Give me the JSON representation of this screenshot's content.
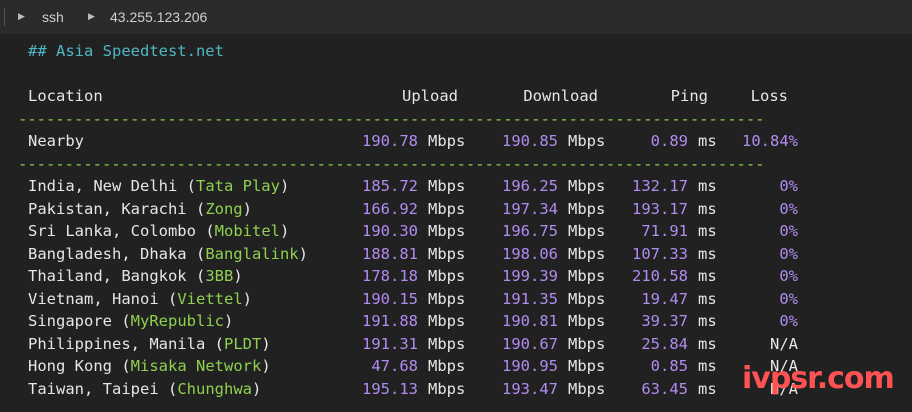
{
  "titlebar": {
    "tab": "ssh",
    "host": "43.255.123.206"
  },
  "section_heading": "## Asia Speedtest.net",
  "table": {
    "headers": {
      "location": "Location",
      "upload": "Upload",
      "download": "Download",
      "ping": "Ping",
      "loss": "Loss"
    },
    "divider": "--------------------------------------------------------------------------------",
    "unit_speed": "Mbps",
    "unit_ping": "ms",
    "nearby": {
      "location": "Nearby",
      "upload": "190.78",
      "download": "190.85",
      "ping": "0.89",
      "loss": "10.84%"
    },
    "rows": [
      {
        "city": "India, New Delhi",
        "isp": "Tata Play",
        "upload": "185.72",
        "download": "196.25",
        "ping": "132.17",
        "loss": "0%"
      },
      {
        "city": "Pakistan, Karachi",
        "isp": "Zong",
        "upload": "166.92",
        "download": "197.34",
        "ping": "193.17",
        "loss": "0%"
      },
      {
        "city": "Sri Lanka, Colombo",
        "isp": "Mobitel",
        "upload": "190.30",
        "download": "196.75",
        "ping": "71.91",
        "loss": "0%"
      },
      {
        "city": "Bangladesh, Dhaka",
        "isp": "Banglalink",
        "upload": "188.81",
        "download": "198.06",
        "ping": "107.33",
        "loss": "0%"
      },
      {
        "city": "Thailand, Bangkok",
        "isp": "3BB",
        "upload": "178.18",
        "download": "199.39",
        "ping": "210.58",
        "loss": "0%"
      },
      {
        "city": "Vietnam, Hanoi",
        "isp": "Viettel",
        "upload": "190.15",
        "download": "191.35",
        "ping": "19.47",
        "loss": "0%"
      },
      {
        "city": "Singapore",
        "isp": "MyRepublic",
        "upload": "191.88",
        "download": "190.81",
        "ping": "39.37",
        "loss": "0%"
      },
      {
        "city": "Philippines, Manila",
        "isp": "PLDT",
        "upload": "191.31",
        "download": "190.67",
        "ping": "25.84",
        "loss": "N/A"
      },
      {
        "city": "Hong Kong",
        "isp": "Misaka Network",
        "upload": "47.68",
        "download": "190.95",
        "ping": "0.85",
        "loss": "N/A"
      },
      {
        "city": "Taiwan, Taipei",
        "isp": "Chunghwa",
        "upload": "195.13",
        "download": "193.47",
        "ping": "63.45",
        "loss": "N/A"
      }
    ]
  },
  "watermark": "ivpsr.com",
  "colors": {
    "background": "#212121",
    "heading": "#4fb7c4",
    "value": "#b18cf0",
    "isp": "#8fd14f",
    "watermark": "#ff5252"
  }
}
